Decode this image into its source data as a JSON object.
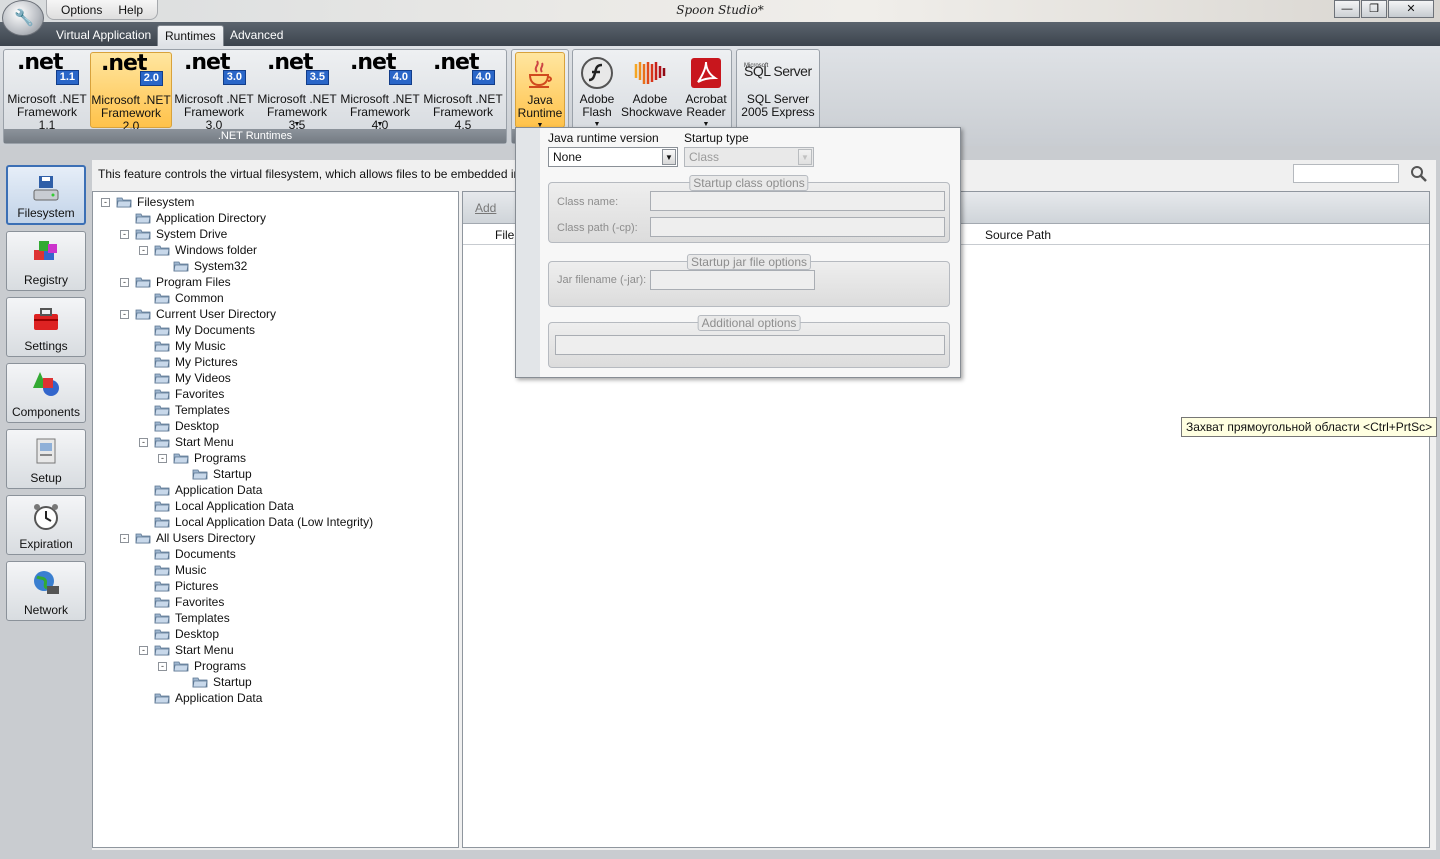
{
  "window": {
    "title": "Spoon Studio*",
    "menu": [
      "Options",
      "Help"
    ],
    "controls": [
      "minimize",
      "restore",
      "close"
    ]
  },
  "tabs": [
    {
      "label": "Virtual Application",
      "active": false
    },
    {
      "label": "Runtimes",
      "active": true
    },
    {
      "label": "Advanced",
      "active": false
    }
  ],
  "ribbon": {
    "net_group_caption": ".NET Runtimes",
    "net_items": [
      {
        "logo": ".net",
        "version": "1.1",
        "line1": "Microsoft .NET",
        "line2": "Framework 1.1",
        "selected": false,
        "dropdown": false
      },
      {
        "logo": ".net",
        "version": "2.0",
        "line1": "Microsoft .NET",
        "line2": "Framework 2.0",
        "selected": true,
        "dropdown": false
      },
      {
        "logo": ".net",
        "version": "3.0",
        "line1": "Microsoft .NET",
        "line2": "Framework 3.0",
        "selected": false,
        "dropdown": false
      },
      {
        "logo": ".net",
        "version": "3.5",
        "line1": "Microsoft .NET",
        "line2": "Framework 3.5",
        "selected": false,
        "dropdown": true
      },
      {
        "logo": ".net",
        "version": "4.0",
        "line1": "Microsoft .NET",
        "line2": "Framework 4.0",
        "selected": false,
        "dropdown": true
      },
      {
        "logo": ".net",
        "version": "4.0",
        "line1": "Microsoft .NET",
        "line2": "Framework 4.5",
        "selected": false,
        "dropdown": false
      }
    ],
    "java": {
      "line1": "Java",
      "line2": "Runtime",
      "selected": true
    },
    "plugins": [
      {
        "line1": "Adobe",
        "line2": "Flash",
        "icon": "flash-icon",
        "dropdown": true
      },
      {
        "line1": "Adobe",
        "line2": "Shockwave",
        "icon": "shockwave-icon",
        "dropdown": false
      },
      {
        "line1": "Acrobat",
        "line2": "Reader",
        "icon": "acrobat-icon",
        "dropdown": true
      }
    ],
    "sql": {
      "logo_small": "Microsoft",
      "logo": "SQL Server",
      "line1": "SQL Server",
      "line2": "2005 Express"
    }
  },
  "sidebar": [
    {
      "label": "Filesystem",
      "icon": "filesystem-icon",
      "active": true
    },
    {
      "label": "Registry",
      "icon": "registry-icon",
      "active": false
    },
    {
      "label": "Settings",
      "icon": "settings-icon",
      "active": false
    },
    {
      "label": "Components",
      "icon": "components-icon",
      "active": false
    },
    {
      "label": "Setup",
      "icon": "setup-icon",
      "active": false
    },
    {
      "label": "Expiration",
      "icon": "expiration-icon",
      "active": false
    },
    {
      "label": "Network",
      "icon": "network-icon",
      "active": false
    }
  ],
  "description": "This feature controls the virtual filesystem, which allows files to be embedded in the applic",
  "tree": [
    {
      "label": "Filesystem",
      "depth": 0,
      "expander": "-"
    },
    {
      "label": "Application Directory",
      "depth": 1,
      "expander": ""
    },
    {
      "label": "System Drive",
      "depth": 1,
      "expander": "-"
    },
    {
      "label": "Windows folder",
      "depth": 2,
      "expander": "-"
    },
    {
      "label": "System32",
      "depth": 3,
      "expander": ""
    },
    {
      "label": "Program Files",
      "depth": 1,
      "expander": "-"
    },
    {
      "label": "Common",
      "depth": 2,
      "expander": ""
    },
    {
      "label": "Current User Directory",
      "depth": 1,
      "expander": "-"
    },
    {
      "label": "My Documents",
      "depth": 2,
      "expander": ""
    },
    {
      "label": "My Music",
      "depth": 2,
      "expander": ""
    },
    {
      "label": "My Pictures",
      "depth": 2,
      "expander": ""
    },
    {
      "label": "My Videos",
      "depth": 2,
      "expander": ""
    },
    {
      "label": "Favorites",
      "depth": 2,
      "expander": ""
    },
    {
      "label": "Templates",
      "depth": 2,
      "expander": ""
    },
    {
      "label": "Desktop",
      "depth": 2,
      "expander": ""
    },
    {
      "label": "Start Menu",
      "depth": 2,
      "expander": "-"
    },
    {
      "label": "Programs",
      "depth": 3,
      "expander": "-"
    },
    {
      "label": "Startup",
      "depth": 4,
      "expander": ""
    },
    {
      "label": "Application Data",
      "depth": 2,
      "expander": ""
    },
    {
      "label": "Local Application Data",
      "depth": 2,
      "expander": ""
    },
    {
      "label": "Local Application Data (Low Integrity)",
      "depth": 2,
      "expander": ""
    },
    {
      "label": "All Users Directory",
      "depth": 1,
      "expander": "-"
    },
    {
      "label": "Documents",
      "depth": 2,
      "expander": ""
    },
    {
      "label": "Music",
      "depth": 2,
      "expander": ""
    },
    {
      "label": "Pictures",
      "depth": 2,
      "expander": ""
    },
    {
      "label": "Favorites",
      "depth": 2,
      "expander": ""
    },
    {
      "label": "Templates",
      "depth": 2,
      "expander": ""
    },
    {
      "label": "Desktop",
      "depth": 2,
      "expander": ""
    },
    {
      "label": "Start Menu",
      "depth": 2,
      "expander": "-"
    },
    {
      "label": "Programs",
      "depth": 3,
      "expander": "-"
    },
    {
      "label": "Startup",
      "depth": 4,
      "expander": ""
    },
    {
      "label": "Application Data",
      "depth": 2,
      "expander": ""
    }
  ],
  "files": {
    "toolbar_add": "Add",
    "columns": [
      "Filen",
      "Source Path"
    ]
  },
  "java_popup": {
    "version_label": "Java runtime version",
    "version_value": "None",
    "startup_label": "Startup type",
    "startup_value": "Class",
    "class_group": "Startup class options",
    "class_name_label": "Class name:",
    "class_path_label": "Class path (-cp):",
    "jar_group": "Startup jar file options",
    "jar_label": "Jar filename (-jar):",
    "additional_group": "Additional options"
  },
  "tooltip": "Захват прямоугольной области <Ctrl+PrtSc>"
}
